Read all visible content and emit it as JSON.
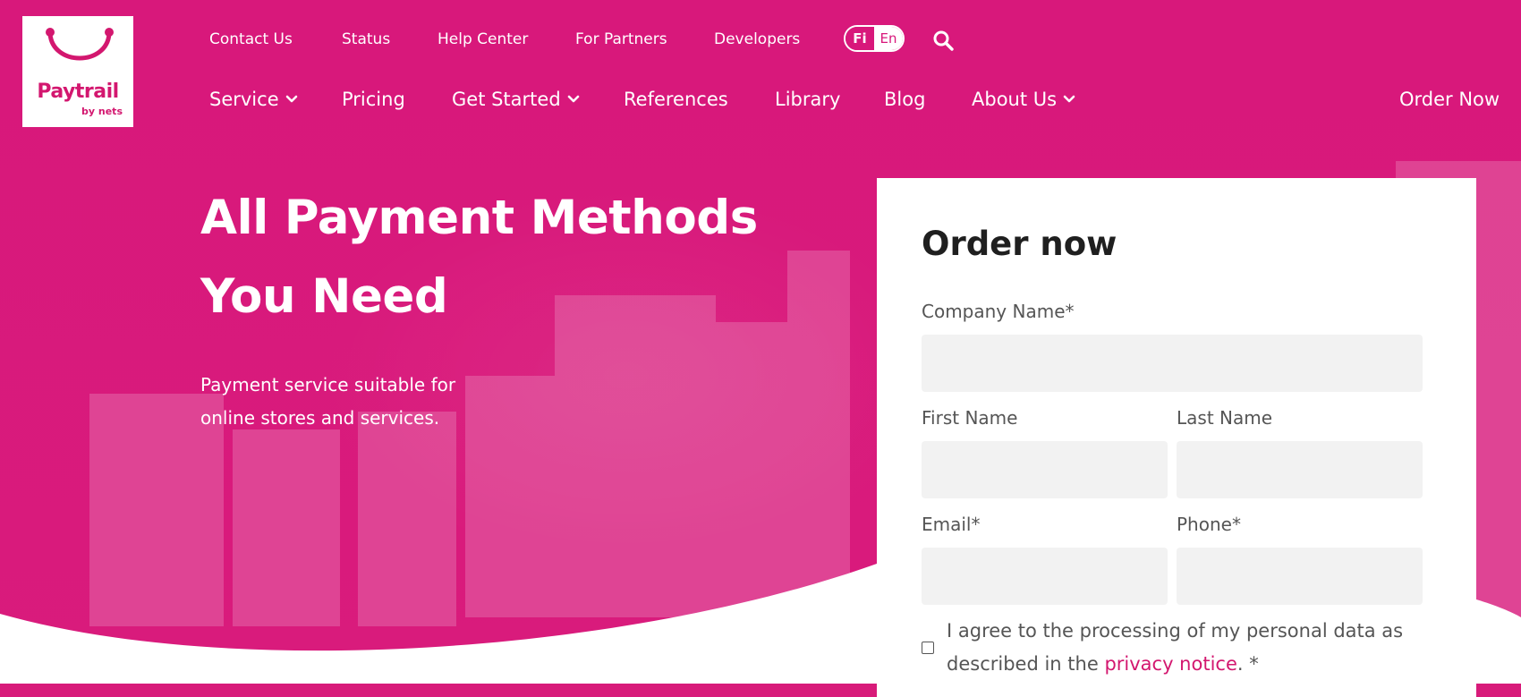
{
  "brand": {
    "name": "Paytrail",
    "sub": "by nets",
    "color": "#d8187b"
  },
  "utility_nav": [
    "Contact Us",
    "Status",
    "Help Center",
    "For Partners",
    "Developers"
  ],
  "language": {
    "fi": "Fi",
    "en": "En",
    "active": "Fi"
  },
  "main_nav": [
    {
      "label": "Service",
      "dropdown": true
    },
    {
      "label": "Pricing",
      "dropdown": false
    },
    {
      "label": "Get Started",
      "dropdown": true
    },
    {
      "label": "References",
      "dropdown": false
    },
    {
      "label": "Library",
      "dropdown": false
    },
    {
      "label": "Blog",
      "dropdown": false
    },
    {
      "label": "About Us",
      "dropdown": true
    }
  ],
  "order_now_link": "Order Now",
  "hero": {
    "title_line1": "All Payment Methods",
    "title_line2": "You Need",
    "subtitle_line1": "Payment service suitable for",
    "subtitle_line2": "online stores and services."
  },
  "form": {
    "title": "Order now",
    "company_label": "Company Name*",
    "first_name_label": "First Name",
    "last_name_label": "Last Name",
    "email_label": "Email*",
    "phone_label": "Phone*",
    "consent_text": "I agree to the processing of my personal data as described in the",
    "consent_link": "privacy notice",
    "consent_suffix": ".  *"
  }
}
